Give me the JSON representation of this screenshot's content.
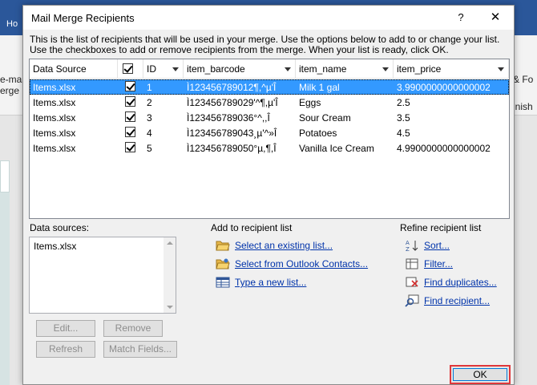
{
  "background": {
    "left_texts": [
      "Ho",
      "e-mail",
      "erge"
    ],
    "right_texts": [
      "& Fo",
      "inish"
    ]
  },
  "dialog": {
    "title": "Mail Merge Recipients",
    "help_label": "?",
    "close_label": "✕",
    "intro_line1": "This is the list of recipients that will be used in your merge.  Use the options below to add to or change your list.",
    "intro_line2": "Use the checkboxes to add or remove recipients from the merge.  When your list is ready, click OK."
  },
  "table": {
    "columns": [
      "Data Source",
      "",
      "ID",
      "item_barcode",
      "item_name",
      "item_price"
    ],
    "rows": [
      {
        "source": "Items.xlsx",
        "checked": true,
        "id": "1",
        "barcode": "Ì123456789012¶,^µ'Î",
        "name": "Milk 1 gal",
        "price": "3.9900000000000002"
      },
      {
        "source": "Items.xlsx",
        "checked": true,
        "id": "2",
        "barcode": "Ì123456789029'^¶,µ'Î",
        "name": "Eggs",
        "price": "2.5"
      },
      {
        "source": "Items.xlsx",
        "checked": true,
        "id": "3",
        "barcode": "Ì123456789036°^,,Î",
        "name": "Sour Cream",
        "price": "3.5"
      },
      {
        "source": "Items.xlsx",
        "checked": true,
        "id": "4",
        "barcode": "Ì123456789043¸µ'^»Î",
        "name": "Potatoes",
        "price": "4.5"
      },
      {
        "source": "Items.xlsx",
        "checked": true,
        "id": "5",
        "barcode": "Ì123456789050°µ,¶,Î",
        "name": "Vanilla Ice Cream",
        "price": "4.9900000000000002"
      }
    ]
  },
  "data_sources": {
    "label": "Data sources:",
    "items": [
      "Items.xlsx"
    ],
    "edit_label": "Edit...",
    "remove_label": "Remove",
    "refresh_label": "Refresh",
    "match_fields_label": "Match Fields..."
  },
  "add_recipient": {
    "label": "Add to recipient list",
    "select_existing": "Select an existing list...",
    "select_outlook": "Select from Outlook Contacts...",
    "type_new": "Type a new list..."
  },
  "refine": {
    "label": "Refine recipient list",
    "sort": "Sort...",
    "filter": "Filter...",
    "find_duplicates": "Find duplicates...",
    "find_recipient": "Find recipient..."
  },
  "ok_label": "OK"
}
